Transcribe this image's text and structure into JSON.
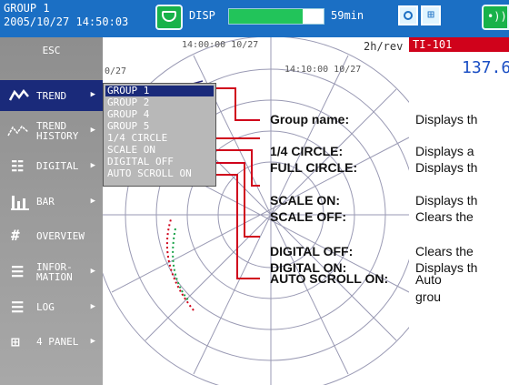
{
  "header": {
    "group_line": "GROUP 1",
    "datetime": "2005/10/27 14:50:03",
    "disp_label": "DISP",
    "memory_fraction": 0.78,
    "memory_label": "59min",
    "partial_icon_label": "•))"
  },
  "sidebar": {
    "items": [
      {
        "label": "ESC",
        "icon": "esc"
      },
      {
        "label": "TREND",
        "icon": "trend-icon"
      },
      {
        "label": "TREND HISTORY",
        "line1": "TREND",
        "line2": "HISTORY",
        "icon": "trend-history-icon"
      },
      {
        "label": "DIGITAL",
        "icon": "digital-icon"
      },
      {
        "label": "BAR",
        "icon": "bar-icon"
      },
      {
        "label": "OVERVIEW",
        "icon": "overview-icon"
      },
      {
        "label": "INFORMATION",
        "line1": "INFOR-",
        "line2": "MATION",
        "icon": "information-icon"
      },
      {
        "label": "LOG",
        "icon": "log-icon"
      },
      {
        "label": "4 PANEL",
        "icon": "4-panel-icon"
      }
    ]
  },
  "chart": {
    "time_top": "14:00:00 10/27",
    "time_mid": "14:10:00 10/27",
    "left_date": "0/27",
    "rev": "2h/rev",
    "tag": "TI-101",
    "value": "137.6"
  },
  "menu": {
    "items": [
      "GROUP 1",
      "GROUP 2",
      "GROUP 4",
      "GROUP 5",
      "1/4 CIRCLE",
      "SCALE ON",
      "DIGITAL OFF",
      "AUTO SCROLL ON"
    ],
    "selected_index": 0
  },
  "legend": {
    "group_key": "Group name:",
    "group_desc": "Displays th",
    "quarter_key": "1/4 CIRCLE:",
    "quarter_desc": "Displays a",
    "full_key": "FULL CIRCLE:",
    "full_desc": "Displays th",
    "scale_on_key": "SCALE ON:",
    "scale_on_desc": "Displays th",
    "scale_off_key": "SCALE OFF:",
    "scale_off_desc": "Clears the",
    "digital_off_key": "DIGITAL OFF:",
    "digital_off_desc": "Clears the",
    "digital_on_key": "DIGITAL ON:",
    "digital_on_desc": "Displays th",
    "auto_key": "AUTO SCROLL ON:",
    "auto_desc1": "Auto",
    "auto_desc2": "grou"
  },
  "colors": {
    "accent": "#1b6fc4",
    "selected": "#1a2a7a",
    "callout": "#d0021b"
  }
}
